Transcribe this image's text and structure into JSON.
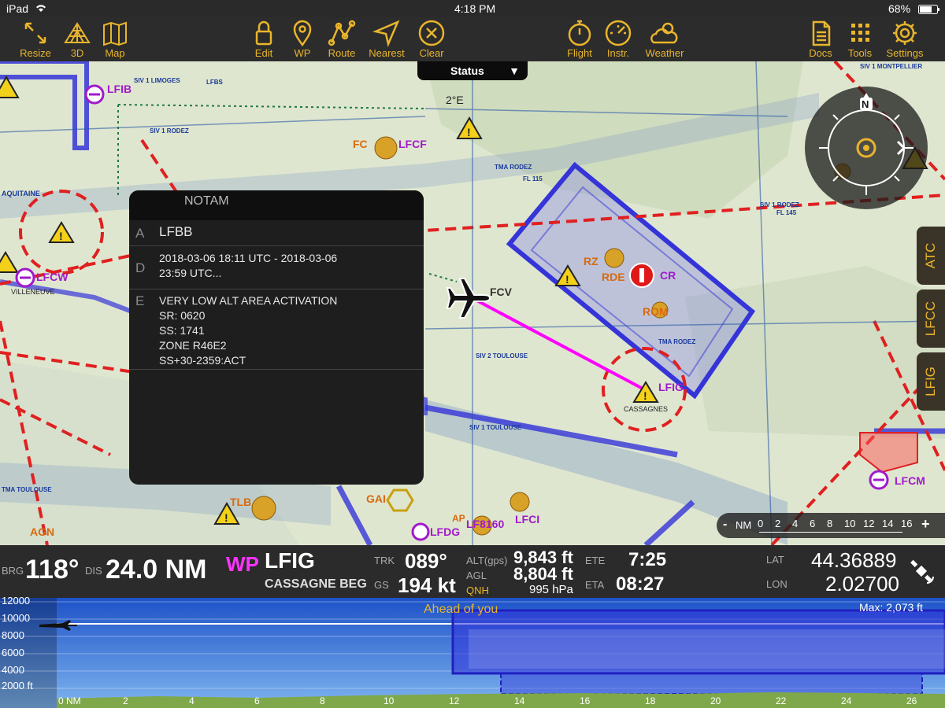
{
  "statusbar": {
    "device": "iPad",
    "time": "4:18 PM",
    "battery": "68%"
  },
  "toolbar": {
    "resize": "Resize",
    "threeD": "3D",
    "map": "Map",
    "edit": "Edit",
    "wp": "WP",
    "route": "Route",
    "nearest": "Nearest",
    "clear": "Clear",
    "flight": "Flight",
    "instr": "Instr.",
    "weather": "Weather",
    "docs": "Docs",
    "tools": "Tools",
    "settings": "Settings"
  },
  "status_tab": {
    "label": "Status"
  },
  "notam": {
    "title": "NOTAM",
    "a_key": "A",
    "a_value": "LFBB",
    "d_key": "D",
    "d_value": "2018-03-06 18:11 UTC - 2018-03-06\n23:59 UTC...",
    "e_key": "E",
    "e_value": "VERY LOW ALT AREA ACTIVATION\nSR: 0620\nSS: 1741\nZONE R46E2\nSS+30-2359:ACT"
  },
  "map_labels": {
    "lfib": "LFIB",
    "lfcf": "LFCF",
    "lfcw": "LFCW",
    "fcv": "FCV",
    "lfig": "LFIG",
    "cassagnes": "CASSAGNES",
    "rz": "RZ",
    "rde": "RDE",
    "rom": "ROM",
    "cr": "CR",
    "lfcm": "LFCM",
    "tlb": "TLB",
    "gai": "GAI",
    "agn": "AGN",
    "lfdg": "LFDG",
    "lf8160": "LF8160",
    "lfci": "LFCI",
    "ap": "AP",
    "two_e": "2°E",
    "fc": "FC",
    "lbl_siv_limoges": "SIV 1 LIMOGES",
    "lbl_siv_rodez": "SIV 1 RODEZ",
    "lbl_siv_montpellier": "SIV 1 MONTPELLIER",
    "lbl_siv2_toulouse": "SIV 2 TOULOUSE",
    "lbl_siv1_toulouse": "SIV 1 TOULOUSE",
    "lbl_tma_rodez": "TMA RODEZ",
    "lbl_tma_toulouse": "TMA TOULOUSE",
    "lbl_aquitaine": "AQUITAINE",
    "lbl_villeneuve": "VILLENEUVE",
    "lbl_lfbs": "LFBS",
    "lbl_fl115": "FL 115",
    "lbl_fl145": "FL 145"
  },
  "side_tabs": {
    "atc": "ATC",
    "lfcc": "LFCC",
    "lfig": "LFIG"
  },
  "scale": {
    "minus": "-",
    "unit": "NM",
    "plus": "+",
    "ticks": [
      "0",
      "2",
      "4",
      "6",
      "8",
      "10",
      "12",
      "14",
      "16"
    ]
  },
  "info": {
    "brg_label": "BRG",
    "brg_value": "118°",
    "dis_label": "DIS",
    "dis_value": "24.0 NM",
    "wp_label": "WP",
    "wp_code": "LFIG",
    "wp_name": "CASSAGNE BEG",
    "trk_label": "TRK",
    "trk_value": "089°",
    "gs_label": "GS",
    "gs_value": "194 kt",
    "alt_label": "ALT(gps)",
    "alt_value": "9,843 ft",
    "agl_label": "AGL",
    "agl_value": "8,804 ft",
    "qnh_label": "QNH",
    "qnh_value": "995 hPa",
    "ete_label": "ETE",
    "ete_value": "7:25",
    "eta_label": "ETA",
    "eta_value": "08:27",
    "lat_label": "LAT",
    "lat_value": "44.36889",
    "lon_label": "LON",
    "lon_value": "2.02700"
  },
  "profile": {
    "ahead": "Ahead of you",
    "max": "Max: 2,073 ft",
    "alt_ticks": [
      "12000",
      "10000",
      "8000",
      "6000",
      "4000",
      "2000 ft"
    ],
    "dist_ticks": [
      "0 NM",
      "2",
      "4",
      "6",
      "8",
      "10",
      "12",
      "14",
      "16",
      "18",
      "20",
      "22",
      "24",
      "26"
    ]
  },
  "colors": {
    "accent": "#e9b52b",
    "route": "#ff00ff",
    "airspace": "#3434d8",
    "danger": "#e02020"
  }
}
